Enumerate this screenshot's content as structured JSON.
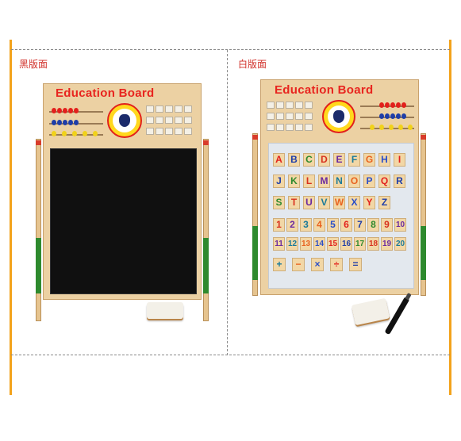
{
  "panels": {
    "left_label": "黑版面",
    "right_label": "白版面",
    "board_title_left": "Education Board",
    "board_title_right": "Education Board"
  },
  "colors": {
    "frame_accent": "#f3a21b",
    "title_red": "#e8251f",
    "wood": "#ecd1a3",
    "blackboard": "#101010",
    "whiteboard": "#e3e8ee"
  },
  "magnet_rows": {
    "row1": [
      "A",
      "B",
      "C",
      "D",
      "E",
      "F",
      "G",
      "H",
      "I"
    ],
    "row2": [
      "J",
      "K",
      "L",
      "M",
      "N",
      "O",
      "P",
      "Q",
      "R"
    ],
    "row3": [
      "S",
      "T",
      "U",
      "V",
      "W",
      "X",
      "Y",
      "Z"
    ],
    "row4": [
      "1",
      "2",
      "3",
      "4",
      "5",
      "6",
      "7",
      "8",
      "9",
      "10"
    ],
    "row5": [
      "11",
      "12",
      "13",
      "14",
      "15",
      "16",
      "17",
      "18",
      "19",
      "20"
    ],
    "row6": [
      "+",
      "−",
      "×",
      "÷",
      "="
    ]
  }
}
